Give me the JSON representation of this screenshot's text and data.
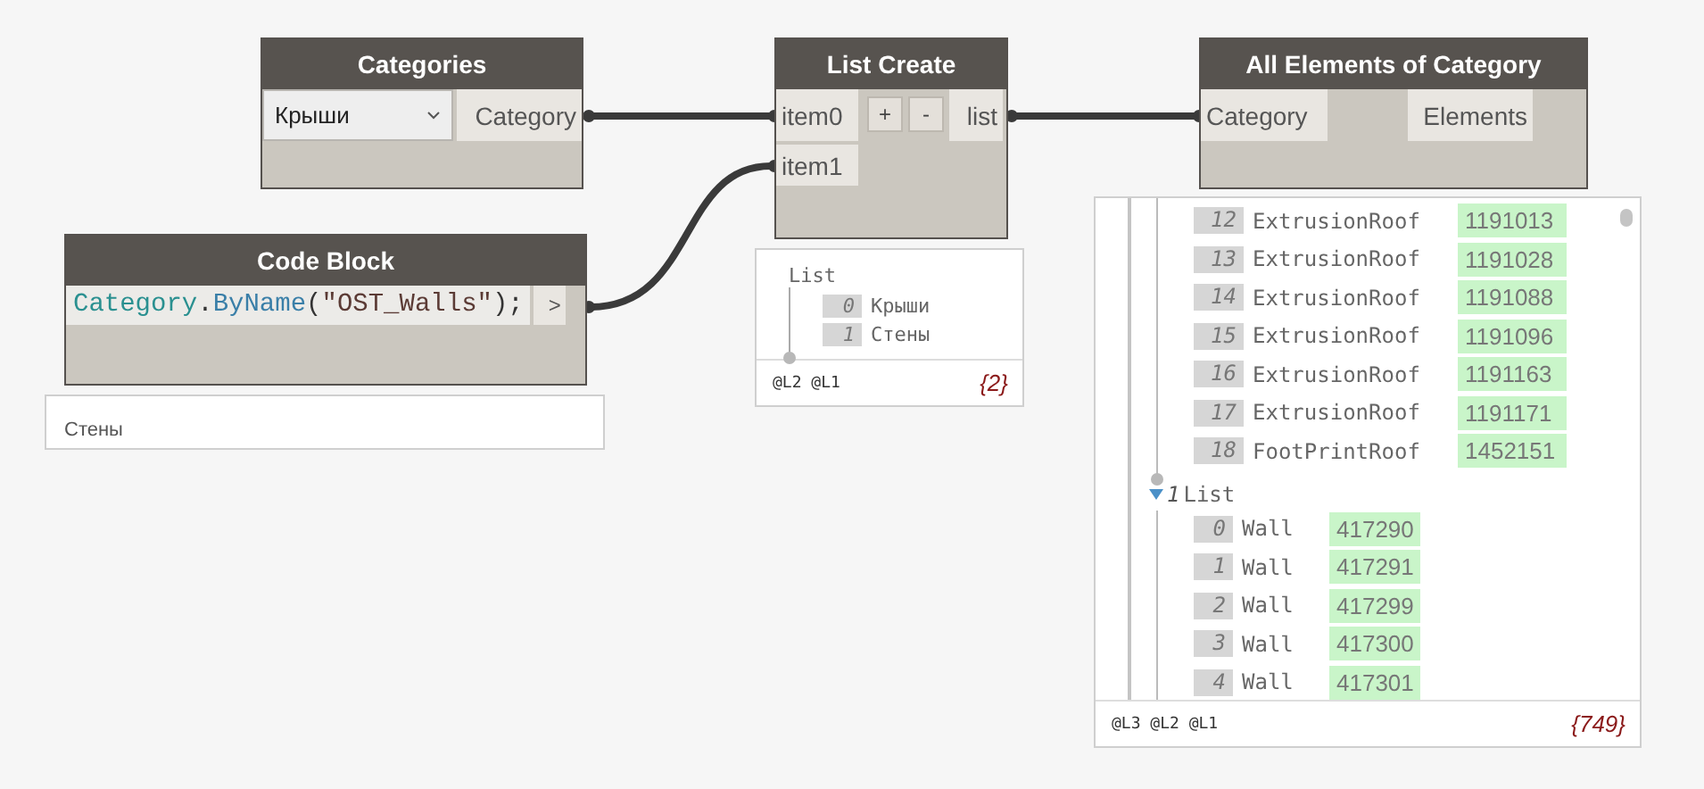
{
  "categories_node": {
    "title": "Categories",
    "dropdown": {
      "value": "Крыши"
    },
    "output": "Category"
  },
  "list_create_node": {
    "title": "List Create",
    "inputs": [
      "item0",
      "item1"
    ],
    "buttons": [
      "+",
      "-"
    ],
    "output": "list"
  },
  "all_elements_node": {
    "title": "All Elements of Category",
    "input": "Category",
    "output": "Elements"
  },
  "code_block_node": {
    "title": "Code Block",
    "code": [
      {
        "kind": "type",
        "text": "Category"
      },
      {
        "kind": "punct",
        "text": "."
      },
      {
        "kind": "method",
        "text": "ByName"
      },
      {
        "kind": "punct",
        "text": "("
      },
      {
        "kind": "string",
        "text": "\"OST_Walls\""
      },
      {
        "kind": "punct",
        "text": ");"
      }
    ],
    "output": ">"
  },
  "code_block_preview": {
    "text": "Стены"
  },
  "list_create_preview": {
    "label": "List",
    "items": [
      {
        "index": "0",
        "value": "Крыши"
      },
      {
        "index": "1",
        "value": "Стены"
      }
    ],
    "levels": "@L2 @L1",
    "count": "{2}"
  },
  "all_elements_preview": {
    "sublist_0": {
      "items": [
        {
          "index": "12",
          "type": "ExtrusionRoof",
          "id": "1191013"
        },
        {
          "index": "13",
          "type": "ExtrusionRoof",
          "id": "1191028"
        },
        {
          "index": "14",
          "type": "ExtrusionRoof",
          "id": "1191088"
        },
        {
          "index": "15",
          "type": "ExtrusionRoof",
          "id": "1191096"
        },
        {
          "index": "16",
          "type": "ExtrusionRoof",
          "id": "1191163"
        },
        {
          "index": "17",
          "type": "ExtrusionRoof",
          "id": "1191171"
        },
        {
          "index": "18",
          "type": "FootPrintRoof",
          "id": "1452151"
        }
      ]
    },
    "sublist_1": {
      "index": "1",
      "label": "List",
      "expanded": true,
      "items": [
        {
          "index": "0",
          "type": "Wall",
          "id": "417290"
        },
        {
          "index": "1",
          "type": "Wall",
          "id": "417291"
        },
        {
          "index": "2",
          "type": "Wall",
          "id": "417299"
        },
        {
          "index": "3",
          "type": "Wall",
          "id": "417300"
        },
        {
          "index": "4",
          "type": "Wall",
          "id": "417301"
        }
      ]
    },
    "levels": "@L3 @L2 @L1",
    "count": "{749}"
  }
}
